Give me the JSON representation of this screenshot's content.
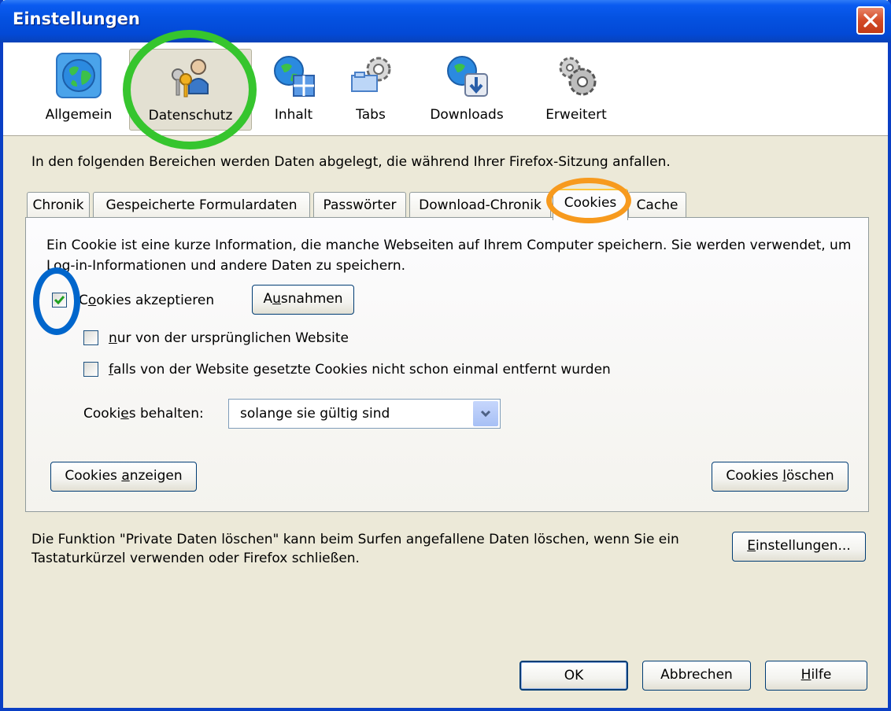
{
  "window": {
    "title": "Einstellungen"
  },
  "toolbar": {
    "items": [
      {
        "label": "Allgemein",
        "icon": "globe-icon"
      },
      {
        "label": "Datenschutz",
        "icon": "privacy-keys-icon"
      },
      {
        "label": "Inhalt",
        "icon": "content-globe-icon"
      },
      {
        "label": "Tabs",
        "icon": "tabs-gear-icon"
      },
      {
        "label": "Downloads",
        "icon": "downloads-globe-icon"
      },
      {
        "label": "Erweitert",
        "icon": "advanced-gears-icon"
      }
    ],
    "selected": "Datenschutz"
  },
  "intro": "In den folgenden Bereichen werden Daten abgelegt, die während Ihrer Firefox-Sitzung anfallen.",
  "tabs": {
    "items": [
      "Chronik",
      "Gespeicherte Formulardaten",
      "Passwörter",
      "Download-Chronik",
      "Cookies",
      "Cache"
    ],
    "active": "Cookies"
  },
  "cookies": {
    "description": "Ein Cookie ist eine kurze Information, die manche Webseiten auf Ihrem Computer speichern. Sie werden verwendet, um Log-in-Informationen und andere Daten zu speichern.",
    "accept": {
      "pre": "C",
      "accel": "o",
      "post": "okies akzeptieren",
      "checked": true
    },
    "exceptions_button": {
      "pre": "A",
      "accel": "u",
      "post": "snahmen"
    },
    "only_origin": {
      "pre": "",
      "accel": "n",
      "post": "ur von der ursprünglichen Website",
      "checked": false
    },
    "if_not_removed": {
      "pre": "",
      "accel": "f",
      "post": "alls von der Website gesetzte Cookies nicht schon einmal entfernt wurden",
      "checked": false
    },
    "keep_label": {
      "pre": "Cooki",
      "accel": "e",
      "post": "s behalten:"
    },
    "keep_value": "solange sie gültig sind",
    "show_button": {
      "pre": "Cookies ",
      "accel": "a",
      "post": "nzeigen"
    },
    "delete_button": {
      "pre": "Cookies ",
      "accel": "l",
      "post": "öschen"
    }
  },
  "private_data": {
    "text": "Die Funktion \"Private Daten löschen\" kann beim Surfen angefallene Daten löschen, wenn Sie ein Tastaturkürzel verwenden oder Firefox schließen.",
    "settings_button": {
      "pre": "",
      "accel": "E",
      "post": "instellungen..."
    }
  },
  "footer": {
    "ok": "OK",
    "cancel": "Abbrechen",
    "help": {
      "pre": "",
      "accel": "H",
      "post": "ilfe"
    }
  },
  "annotations": {
    "green": "#36c52e",
    "orange": "#f79a1e",
    "blue": "#0066cc"
  }
}
